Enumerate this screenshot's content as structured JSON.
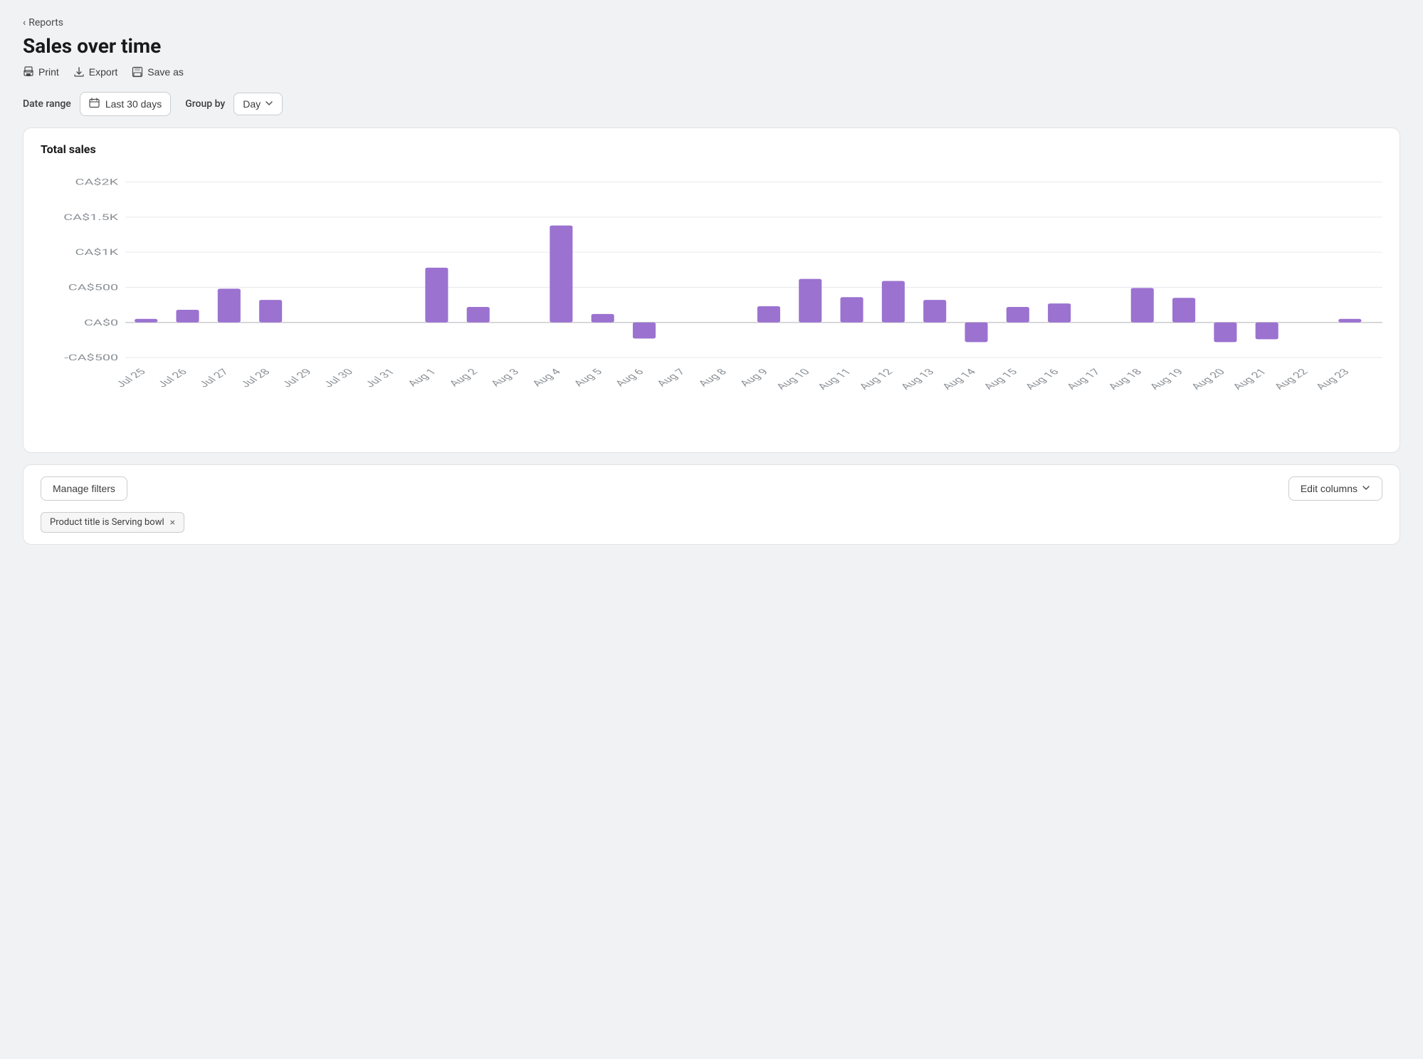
{
  "nav": {
    "back_label": "Reports"
  },
  "page": {
    "title": "Sales over time"
  },
  "toolbar": {
    "print_label": "Print",
    "export_label": "Export",
    "save_as_label": "Save as"
  },
  "filters": {
    "date_range_label": "Date range",
    "date_range_value": "Last 30 days",
    "group_by_label": "Group by",
    "group_by_value": "Day"
  },
  "chart": {
    "title": "Total sales",
    "y_labels": [
      "CA$2K",
      "CA$1.5K",
      "CA$1K",
      "CA$500",
      "CA$0",
      "-CA$500"
    ],
    "x_labels": [
      "Jul 25",
      "Jul 26",
      "Jul 27",
      "Jul 28",
      "Jul 29",
      "Jul 30",
      "Jul 31",
      "Aug 1",
      "Aug 2",
      "Aug 3",
      "Aug 4",
      "Aug 5",
      "Aug 6",
      "Aug 7",
      "Aug 8",
      "Aug 9",
      "Aug 10",
      "Aug 11",
      "Aug 12",
      "Aug 13",
      "Aug 14",
      "Aug 15",
      "Aug 16",
      "Aug 17",
      "Aug 18",
      "Aug 19",
      "Aug 20",
      "Aug 21",
      "Aug 22",
      "Aug 23"
    ],
    "bars": [
      {
        "value": 50,
        "negative": false
      },
      {
        "value": 180,
        "negative": false
      },
      {
        "value": 480,
        "negative": false
      },
      {
        "value": 320,
        "negative": false
      },
      {
        "value": 0,
        "negative": false
      },
      {
        "value": 0,
        "negative": false
      },
      {
        "value": 0,
        "negative": false
      },
      {
        "value": 780,
        "negative": false
      },
      {
        "value": 220,
        "negative": false
      },
      {
        "value": 0,
        "negative": false
      },
      {
        "value": 1380,
        "negative": false
      },
      {
        "value": 120,
        "negative": false
      },
      {
        "value": 230,
        "negative": true
      },
      {
        "value": 0,
        "negative": false
      },
      {
        "value": 0,
        "negative": false
      },
      {
        "value": 230,
        "negative": false
      },
      {
        "value": 620,
        "negative": false
      },
      {
        "value": 360,
        "negative": false
      },
      {
        "value": 590,
        "negative": false
      },
      {
        "value": 320,
        "negative": false
      },
      {
        "value": 280,
        "negative": true
      },
      {
        "value": 220,
        "negative": false
      },
      {
        "value": 270,
        "negative": false
      },
      {
        "value": 0,
        "negative": false
      },
      {
        "value": 490,
        "negative": false
      },
      {
        "value": 350,
        "negative": false
      },
      {
        "value": 280,
        "negative": true
      },
      {
        "value": 240,
        "negative": true
      },
      {
        "value": 0,
        "negative": false
      },
      {
        "value": 50,
        "negative": false
      }
    ]
  },
  "bottom": {
    "manage_filters_label": "Manage filters",
    "edit_columns_label": "Edit columns",
    "filter_tag_label": "Product title is Serving bowl",
    "filter_close_label": "×"
  }
}
